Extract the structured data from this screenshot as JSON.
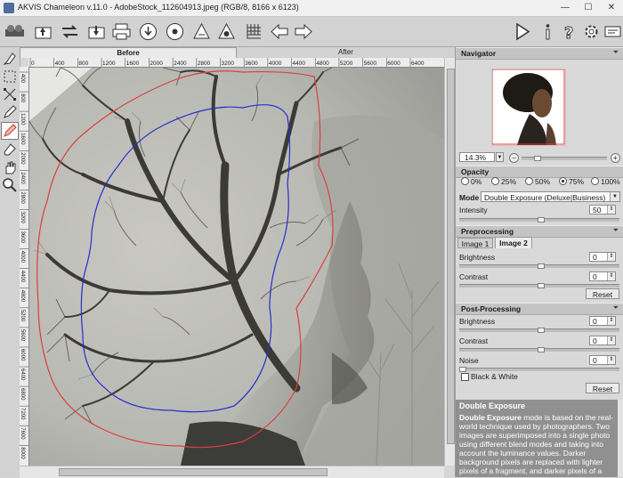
{
  "window": {
    "title": "AKVIS Chameleon v.11.0 - AdobeStock_112604913.jpeg (RGB/8, 8166 x 6123)",
    "minimize": "—",
    "maximize": "☐",
    "close": "✕"
  },
  "toolbar": {
    "icons": [
      "open-icon",
      "save-icon",
      "batch-icon",
      "print-icon",
      "share-icon",
      "plugin-icon",
      "undo-history-icon",
      "grid-icon",
      "back-icon",
      "forward-icon"
    ],
    "right_icons": [
      "run-icon",
      "info-icon",
      "help-icon",
      "settings-icon",
      "preferences-icon"
    ]
  },
  "canvas_tabs": {
    "before": "Before",
    "after": "After"
  },
  "ruler": {
    "top_ticks": [
      "00",
      "400",
      "800",
      "1200",
      "1600",
      "2000",
      "2400",
      "2800",
      "3200",
      "3600",
      "4000",
      "4400",
      "4800",
      "5200",
      "5600",
      "6000"
    ],
    "top_labels": [
      "0",
      "400",
      "800",
      "1200",
      "1600",
      "2000",
      "2400",
      "2800",
      "3200",
      "3600",
      "4000",
      "4400",
      "4800",
      "5200",
      "5600",
      "6000",
      "6400"
    ],
    "left_labels": [
      "400",
      "800",
      "1200",
      "1600",
      "2000",
      "2400",
      "2800",
      "3200",
      "3600",
      "4000",
      "4400",
      "4800",
      "5200",
      "5600",
      "6000",
      "6400",
      "6800",
      "7200",
      "7600",
      "8000"
    ]
  },
  "navigator": {
    "header": "Navigator",
    "zoom": "14.3%"
  },
  "opacity": {
    "header": "Opacity",
    "options": [
      "0%",
      "25%",
      "50%",
      "75%",
      "100%"
    ],
    "selected": "75%"
  },
  "mode": {
    "label": "Mode",
    "value": "Double Exposure (Deluxe|Business)",
    "intensity_label": "Intensity",
    "intensity_value": "50"
  },
  "preprocessing": {
    "header": "Preprocessing",
    "tab1": "Image 1",
    "tab2": "Image 2",
    "brightness_label": "Brightness",
    "brightness_value": "0",
    "contrast_label": "Contrast",
    "contrast_value": "0",
    "reset": "Reset"
  },
  "postprocessing": {
    "header": "Post-Processing",
    "brightness_label": "Brightness",
    "brightness_value": "0",
    "contrast_label": "Contrast",
    "contrast_value": "0",
    "noise_label": "Noise",
    "noise_value": "0",
    "bw_label": "Black & White",
    "reset": "Reset"
  },
  "description": {
    "title": "Double Exposure",
    "lead": "Double Exposure",
    "text": " mode is based on the real-world technique used by photographers. Two images are superimposed into a single photo using different blend modes and taking into account the luminance values. Darker background pixels are replaced with lighter pixels of a fragment, and darker pixels of a fragment"
  },
  "colors": {
    "outer_stroke": "#d8413d",
    "inner_stroke": "#2630c8",
    "panel_bg": "#d9d9d9",
    "desc_bg": "#909090"
  }
}
